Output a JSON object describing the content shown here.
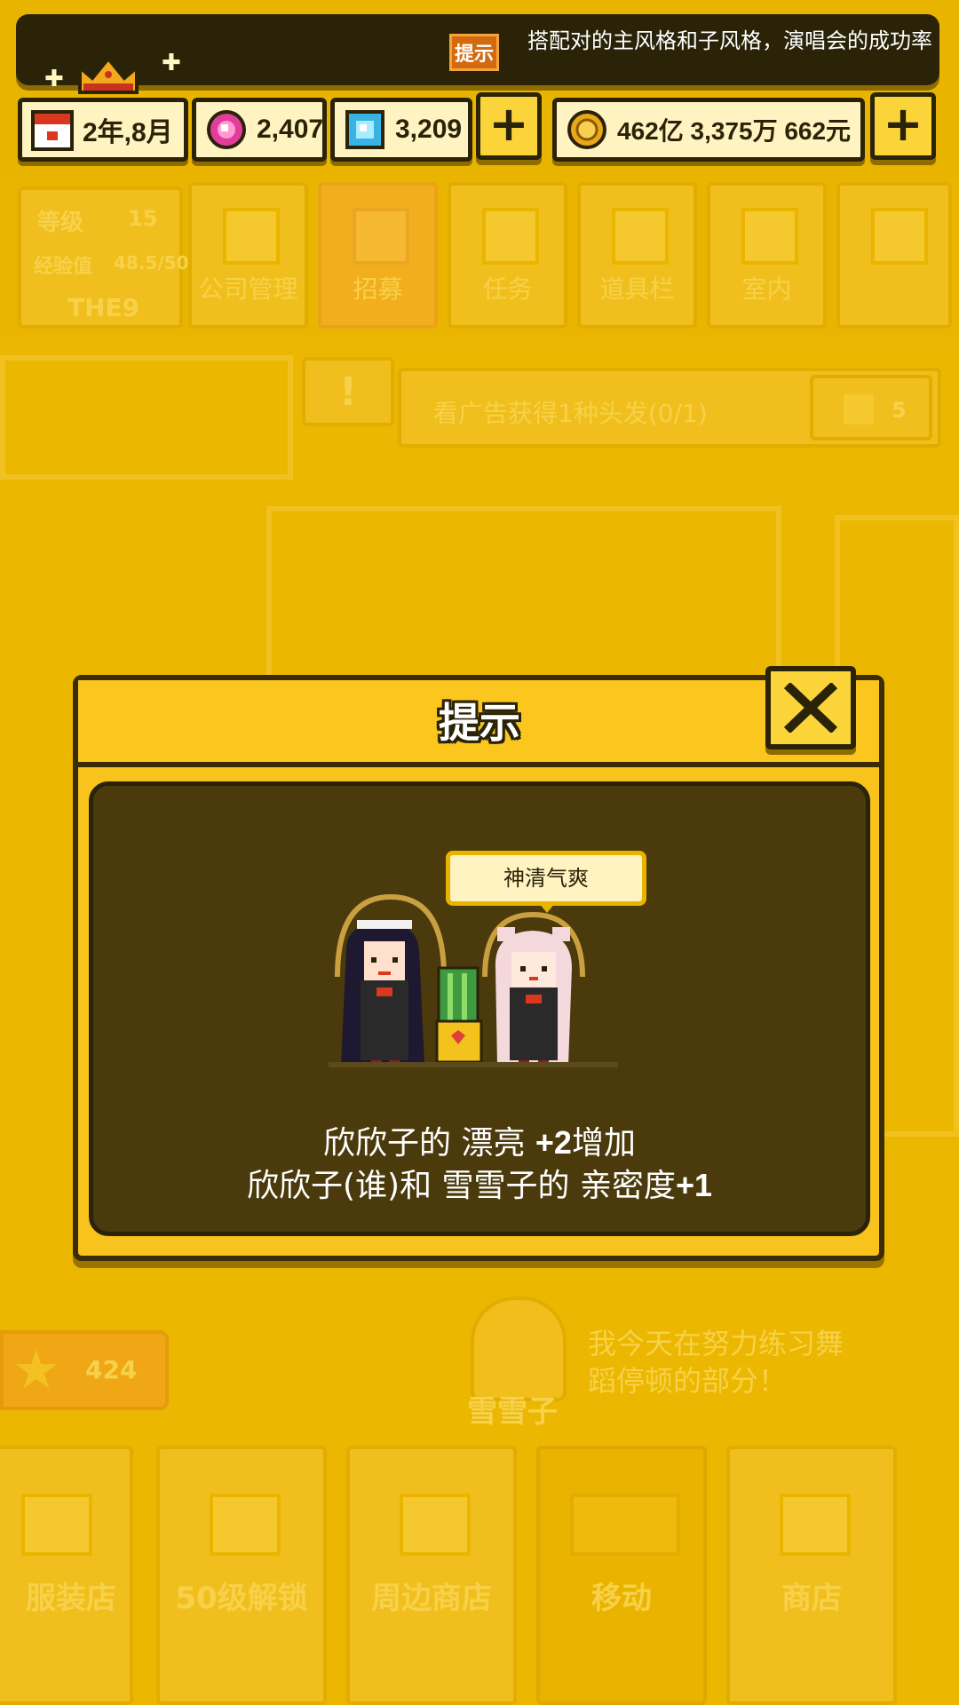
{
  "ticker": {
    "badge": "提示",
    "text": "搭配对的主风格和子风格，演唱会的成功率"
  },
  "currency": {
    "date": "2年,8月",
    "pink_gems": "2,407",
    "blue_gems": "3,209",
    "money": "462亿 3,375万 662元"
  },
  "colors": {
    "accent": "#f7c31c",
    "dark": "#2a2308",
    "panel": "#4a3a0c",
    "overlay": "#e8b400"
  },
  "profile": {
    "level_label": "等级",
    "level": "15",
    "exp_label": "经验值",
    "exp": "48.5/50",
    "name": "THE9"
  },
  "menu": [
    {
      "label": "公司管理",
      "icon": "building-icon"
    },
    {
      "label": "招募",
      "icon": "megaphone-icon"
    },
    {
      "label": "任务",
      "icon": "scroll-icon"
    },
    {
      "label": "道具栏",
      "icon": "chest-icon"
    },
    {
      "label": "室内",
      "icon": "paint-roller-icon"
    },
    {
      "label": "",
      "icon": "mail-icon"
    }
  ],
  "ad_banner": {
    "text": "看广告获得1种头发(0/1)",
    "reward": "5"
  },
  "stars": {
    "count": "424"
  },
  "npc": {
    "name": "雪雪子",
    "speech": "我今天在努力练习舞蹈停顿的部分！"
  },
  "bottom_tabs": [
    {
      "label": "服装店",
      "icon": "shirt-icon"
    },
    {
      "label": "50级解锁",
      "icon": "lock-icon"
    },
    {
      "label": "周边商店",
      "icon": "shop-icon"
    },
    {
      "label": "移动",
      "icon": "bus-icon"
    },
    {
      "label": "商店",
      "icon": "store-icon"
    }
  ],
  "modal": {
    "title": "提示",
    "mood": "神清气爽",
    "line1_prefix": "欣欣子的 漂亮 ",
    "line1_value": "+2",
    "line1_suffix": "增加",
    "line2_prefix": "欣欣子(谁)和 雪雪子的 亲密度",
    "line2_value": "+1"
  }
}
